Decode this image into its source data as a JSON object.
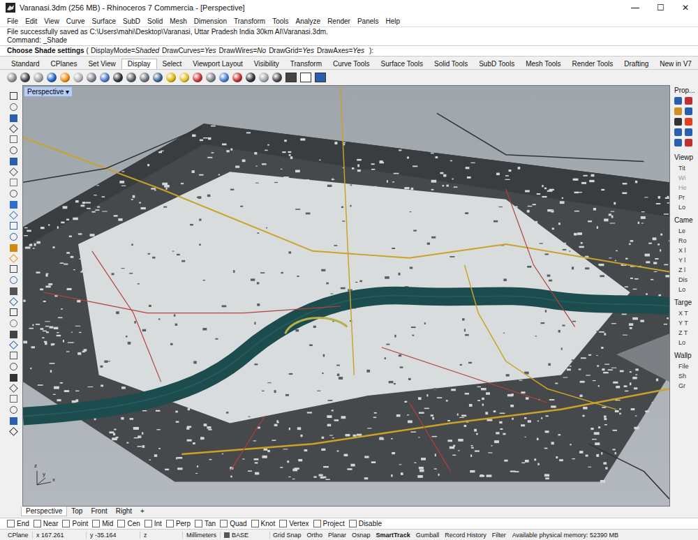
{
  "window": {
    "title": "Varanasi.3dm (256 MB) - Rhinoceros 7 Commercia - [Perspective]",
    "controls": [
      "—",
      "☐",
      "✕"
    ]
  },
  "menu": [
    "File",
    "Edit",
    "View",
    "Curve",
    "Surface",
    "SubD",
    "Solid",
    "Mesh",
    "Dimension",
    "Transform",
    "Tools",
    "Analyze",
    "Render",
    "Panels",
    "Help"
  ],
  "command_history": [
    "File successfully saved as C:\\Users\\mahi\\Desktop\\Varanasi, Uttar Pradesh India 30km AI\\Varanasi.3dm.",
    "Command: _Shade"
  ],
  "prompt": {
    "label": "Choose Shade settings",
    "open": "(",
    "options": [
      {
        "name": "DisplayMode=",
        "value": "Shaded"
      },
      {
        "name": "DrawCurves=",
        "value": "Yes"
      },
      {
        "name": "DrawWires=",
        "value": "No"
      },
      {
        "name": "DrawGrid=",
        "value": "Yes"
      },
      {
        "name": "DrawAxes=",
        "value": "Yes"
      }
    ],
    "close": "):"
  },
  "tabs": [
    {
      "label": "Standard",
      "selected": false
    },
    {
      "label": "CPlanes",
      "selected": false
    },
    {
      "label": "Set View",
      "selected": false
    },
    {
      "label": "Display",
      "selected": true
    },
    {
      "label": "Select",
      "selected": false
    },
    {
      "label": "Viewport Layout",
      "selected": false
    },
    {
      "label": "Visibility",
      "selected": false
    },
    {
      "label": "Transform",
      "selected": false
    },
    {
      "label": "Curve Tools",
      "selected": false
    },
    {
      "label": "Surface Tools",
      "selected": false
    },
    {
      "label": "Solid Tools",
      "selected": false
    },
    {
      "label": "SubD Tools",
      "selected": false
    },
    {
      "label": "Mesh Tools",
      "selected": false
    },
    {
      "label": "Render Tools",
      "selected": false
    },
    {
      "label": "Drafting",
      "selected": false
    },
    {
      "label": "New in V7",
      "selected": false
    }
  ],
  "viewport": {
    "label": "Perspective",
    "menu_glyph": "▾",
    "axes": {
      "z": "z",
      "y": "y",
      "x": "x"
    }
  },
  "properties_panel": {
    "title": "Prop...",
    "sections": [
      {
        "title": "Viewp",
        "fields": [
          {
            "label": "Tit",
            "disabled": false
          },
          {
            "label": "Wi",
            "disabled": true
          },
          {
            "label": "He",
            "disabled": true
          },
          {
            "label": "Pr",
            "disabled": false
          },
          {
            "label": "Lo",
            "disabled": false
          }
        ]
      },
      {
        "title": "Came",
        "fields": [
          {
            "label": "Le",
            "disabled": false
          },
          {
            "label": "Ro",
            "disabled": false
          },
          {
            "label": "X l",
            "disabled": false
          },
          {
            "label": "Y l",
            "disabled": false
          },
          {
            "label": "Z l",
            "disabled": false
          },
          {
            "label": "Dis",
            "disabled": false
          },
          {
            "label": "Lo",
            "disabled": false
          }
        ]
      },
      {
        "title": "Targe",
        "fields": [
          {
            "label": "X T",
            "disabled": false
          },
          {
            "label": "Y T",
            "disabled": false
          },
          {
            "label": "Z T",
            "disabled": false
          },
          {
            "label": "Lo",
            "disabled": false
          }
        ]
      },
      {
        "title": "Wallp",
        "fields": [
          {
            "label": "File",
            "disabled": false
          },
          {
            "label": "Sh",
            "disabled": false
          },
          {
            "label": "Gr",
            "disabled": false
          }
        ]
      }
    ]
  },
  "viewport_tabs": {
    "tabs": [
      {
        "label": "Perspective",
        "selected": true
      },
      {
        "label": "Top",
        "selected": false
      },
      {
        "label": "Front",
        "selected": false
      },
      {
        "label": "Right",
        "selected": false
      }
    ],
    "add": "+"
  },
  "osnaps": [
    {
      "label": "End",
      "checked": false
    },
    {
      "label": "Near",
      "checked": false
    },
    {
      "label": "Point",
      "checked": false
    },
    {
      "label": "Mid",
      "checked": false
    },
    {
      "label": "Cen",
      "checked": false
    },
    {
      "label": "Int",
      "checked": false
    },
    {
      "label": "Perp",
      "checked": false
    },
    {
      "label": "Tan",
      "checked": false
    },
    {
      "label": "Quad",
      "checked": false
    },
    {
      "label": "Knot",
      "checked": false
    },
    {
      "label": "Vertex",
      "checked": false
    },
    {
      "label": "Project",
      "checked": false
    },
    {
      "label": "Disable",
      "checked": false
    }
  ],
  "status_bar": {
    "cplane": "CPlane",
    "x": "x 167.261",
    "y": "y -35.164",
    "z": "z",
    "units": "Millimeters",
    "layer": {
      "label": "BASE",
      "color": "#555555"
    },
    "toggles": [
      {
        "label": "Grid Snap",
        "on": false
      },
      {
        "label": "Ortho",
        "on": false
      },
      {
        "label": "Planar",
        "on": false
      },
      {
        "label": "Osnap",
        "on": false
      },
      {
        "label": "SmartTrack",
        "on": true
      },
      {
        "label": "Gumball",
        "on": false
      },
      {
        "label": "Record History",
        "on": false
      },
      {
        "label": "Filter",
        "on": false
      }
    ],
    "memory": "Available physical memory: 52390 MB"
  }
}
